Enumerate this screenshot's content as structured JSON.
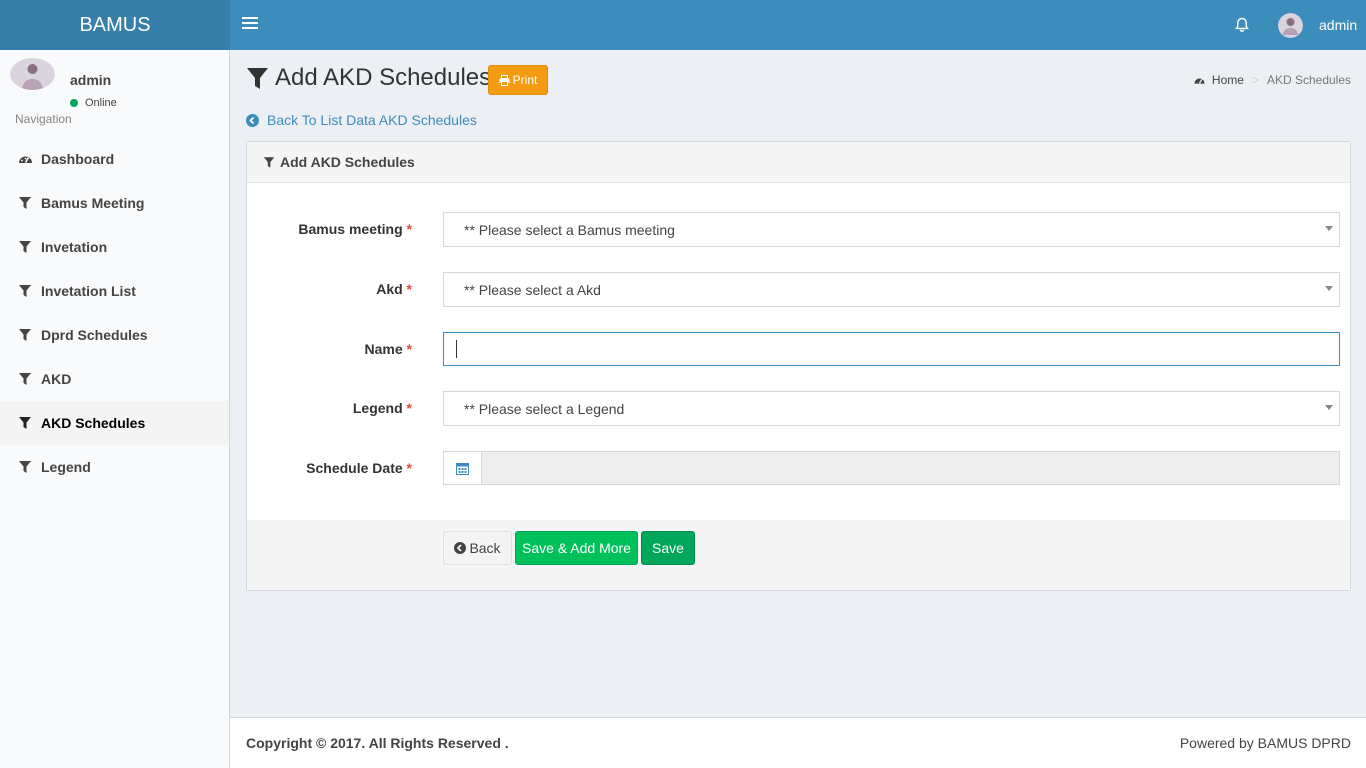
{
  "app": {
    "brand": "BAMUS"
  },
  "header": {
    "username": "admin",
    "icons": {
      "menu": "hamburger-icon",
      "notifications": "bell-icon"
    }
  },
  "sidebar": {
    "user": {
      "name": "admin",
      "status": "Online"
    },
    "nav_header": "Navigation",
    "items": [
      {
        "label": "Dashboard",
        "icon": "dashboard-icon"
      },
      {
        "label": "Bamus Meeting",
        "icon": "filter-icon"
      },
      {
        "label": "Invetation",
        "icon": "filter-icon"
      },
      {
        "label": "Invetation List",
        "icon": "filter-icon"
      },
      {
        "label": "Dprd Schedules",
        "icon": "filter-icon"
      },
      {
        "label": "AKD",
        "icon": "filter-icon"
      },
      {
        "label": "AKD Schedules",
        "icon": "filter-icon",
        "active": true
      },
      {
        "label": "Legend",
        "icon": "filter-icon"
      }
    ]
  },
  "page": {
    "title": "Add AKD Schedules",
    "print_label": "Print",
    "breadcrumb": {
      "home": "Home",
      "current": "AKD Schedules"
    },
    "back_link": "Back To List Data AKD Schedules"
  },
  "form": {
    "box_title": "Add AKD Schedules",
    "required_mark": "*",
    "fields": {
      "bamus_meeting": {
        "label": "Bamus meeting",
        "placeholder": "** Please select a Bamus meeting"
      },
      "akd": {
        "label": "Akd",
        "placeholder": "** Please select a Akd"
      },
      "name": {
        "label": "Name",
        "value": ""
      },
      "legend": {
        "label": "Legend",
        "placeholder": "** Please select a Legend"
      },
      "schedule_date": {
        "label": "Schedule Date",
        "value": ""
      }
    },
    "buttons": {
      "back": "Back",
      "save_add_more": "Save & Add More",
      "save": "Save"
    }
  },
  "footer": {
    "copyright": "Copyright © 2017. All Rights Reserved .",
    "powered": "Powered by BAMUS DPRD"
  },
  "colors": {
    "header": "#3c8dbc",
    "logo": "#367fa9",
    "print": "#f39c12",
    "success": "#00a65a",
    "required": "#dd4b39"
  }
}
